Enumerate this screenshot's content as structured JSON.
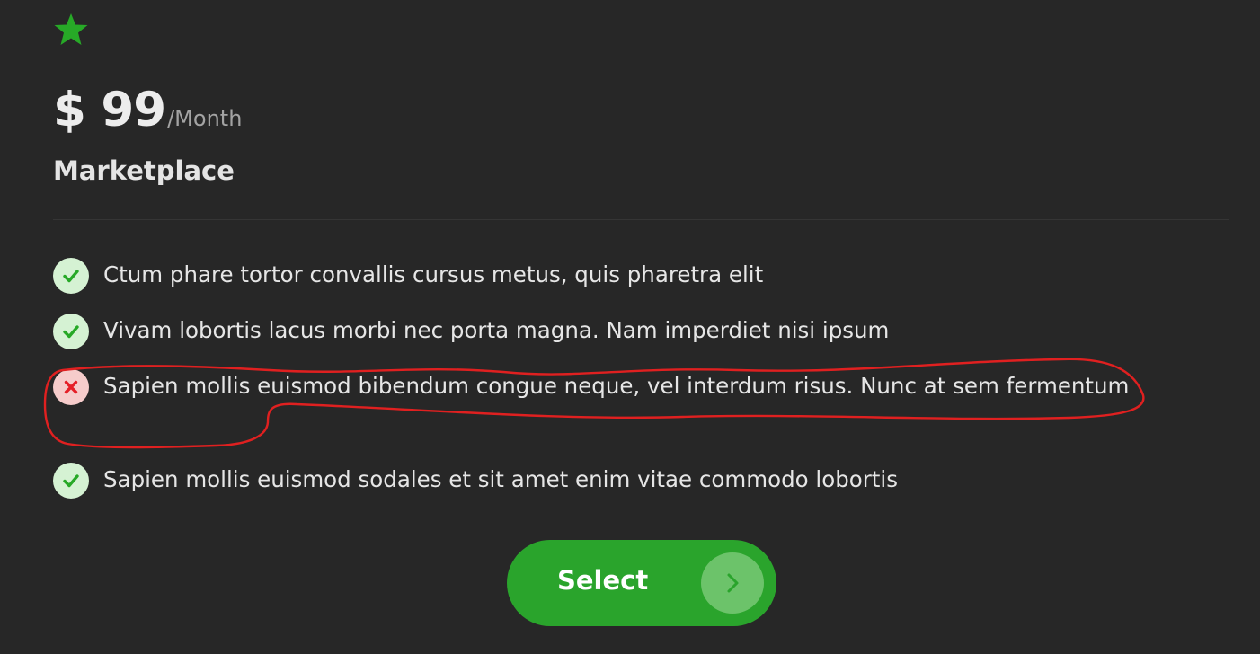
{
  "colors": {
    "background": "#272727",
    "accent": "#2aa42c",
    "check": "#27a927",
    "cross": "#e51f27",
    "annotation": "#e02020"
  },
  "plan": {
    "icon": "star-icon",
    "price": "$ 99",
    "period": "/Month",
    "title": "Marketplace"
  },
  "features": [
    {
      "status": "included",
      "icon": "check-icon",
      "text": "Ctum phare tortor convallis cursus metus, quis pharetra elit"
    },
    {
      "status": "included",
      "icon": "check-icon",
      "text": "Vivam lobortis lacus morbi nec porta magna. Nam imperdiet nisi ipsum"
    },
    {
      "status": "excluded",
      "icon": "cross-icon",
      "text": "Sapien mollis euismod bibendum congue neque, vel interdum risus. Nunc at sem fermentum"
    },
    {
      "status": "included",
      "icon": "check-icon",
      "text": "Sapien mollis euismod sodales et sit amet enim vitae commodo lobortis"
    }
  ],
  "select_button": {
    "label": "Select",
    "icon": "chevron-right-icon"
  }
}
